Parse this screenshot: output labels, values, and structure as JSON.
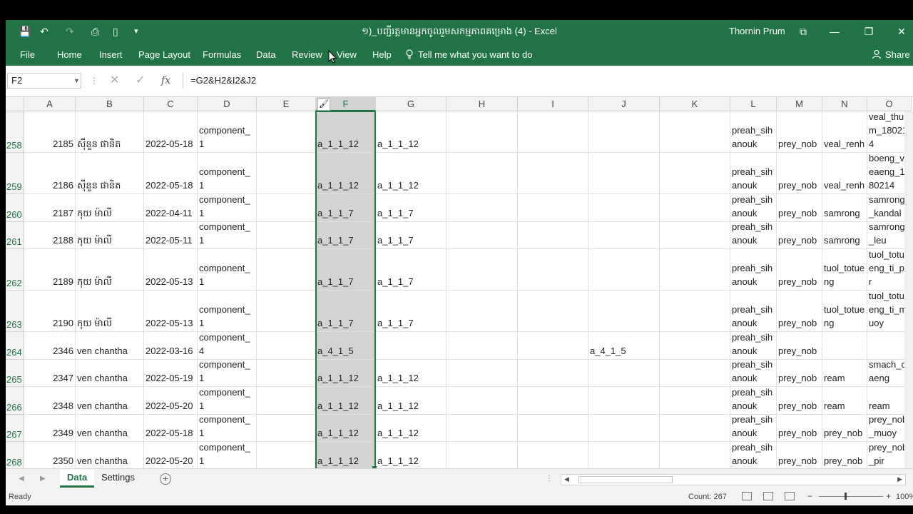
{
  "window": {
    "title": "១)_បញ្ជីរត្តមានអ្នកចូលរួមសកម្មភាពគម្រោង (4)  -  Excel",
    "user": "Thornin Prum",
    "minimize": "—",
    "restore": "❐",
    "close": "✕",
    "ribbon_display": "⧉"
  },
  "qat": {
    "save": "💾",
    "undo": "↶",
    "redo": "↷",
    "print_preview": "⎙",
    "new": "▯",
    "customize": "▾"
  },
  "ribbon": {
    "tabs": [
      "File",
      "Home",
      "Insert",
      "Page Layout",
      "Formulas",
      "Data",
      "Review",
      "View",
      "Help"
    ],
    "tell_me": "Tell me what you want to do",
    "share": "Share"
  },
  "formula_bar": {
    "name_box": "F2",
    "cancel": "✕",
    "enter": "✓",
    "fx": "fx",
    "formula": "=G2&H2&I2&J2"
  },
  "columns": [
    "A",
    "B",
    "C",
    "D",
    "E",
    "F",
    "G",
    "H",
    "I",
    "J",
    "K",
    "L",
    "M",
    "N",
    "O"
  ],
  "selected_column": "F",
  "rows": [
    {
      "num": "258",
      "A": "2185",
      "B": "ស៊ីនួន ផានិត",
      "C": "2022-05-18",
      "D": "component_1",
      "F": "a_1_1_12",
      "G": "a_1_1_12",
      "J": "",
      "L": "preah_sihanouk",
      "M": "prey_nob",
      "N": "veal_renh",
      "O": "veal_thum_180214"
    },
    {
      "num": "259",
      "A": "2186",
      "B": "ស៊ីនួន ផានិត",
      "C": "2022-05-18",
      "D": "component_1",
      "F": "a_1_1_12",
      "G": "a_1_1_12",
      "J": "",
      "L": "preah_sihanouk",
      "M": "prey_nob",
      "N": "veal_renh",
      "O": "boeng_veaeng_180214"
    },
    {
      "num": "260",
      "A": "2187",
      "B": "កុយ ម៉ាលី",
      "C": "2022-04-11",
      "D": "component_1",
      "F": "a_1_1_7",
      "G": "a_1_1_7",
      "J": "",
      "L": "preah_sihanouk",
      "M": "prey_nob",
      "N": "samrong",
      "O": "samrong_kandal"
    },
    {
      "num": "261",
      "A": "2188",
      "B": "កុយ ម៉ាលី",
      "C": "2022-05-11",
      "D": "component_1",
      "F": "a_1_1_7",
      "G": "a_1_1_7",
      "J": "",
      "L": "preah_sihanouk",
      "M": "prey_nob",
      "N": "samrong",
      "O": "samrong_leu"
    },
    {
      "num": "262",
      "A": "2189",
      "B": "កុយ ម៉ាលី",
      "C": "2022-05-13",
      "D": "component_1",
      "F": "a_1_1_7",
      "G": "a_1_1_7",
      "J": "",
      "L": "preah_sihanouk",
      "M": "prey_nob",
      "N": "tuol_totueng",
      "O": "tuol_totueng_ti_pir"
    },
    {
      "num": "263",
      "A": "2190",
      "B": "កុយ ម៉ាលី",
      "C": "2022-05-13",
      "D": "component_1",
      "F": "a_1_1_7",
      "G": "a_1_1_7",
      "J": "",
      "L": "preah_sihanouk",
      "M": "prey_nob",
      "N": "tuol_totueng",
      "O": "tuol_totueng_ti_muoy"
    },
    {
      "num": "264",
      "A": "2346",
      "B": "ven chantha",
      "C": "2022-03-16",
      "D": "component_4",
      "F": "a_4_1_5",
      "G": "",
      "J": "a_4_1_5",
      "L": "preah_sihanouk",
      "M": "prey_nob",
      "N": "",
      "O": ""
    },
    {
      "num": "265",
      "A": "2347",
      "B": "ven chantha",
      "C": "2022-05-19",
      "D": "component_1",
      "F": "a_1_1_12",
      "G": "a_1_1_12",
      "J": "",
      "L": "preah_sihanouk",
      "M": "prey_nob",
      "N": "ream",
      "O": "smach_daeng"
    },
    {
      "num": "266",
      "A": "2348",
      "B": "ven chantha",
      "C": "2022-05-20",
      "D": "component_1",
      "F": "a_1_1_12",
      "G": "a_1_1_12",
      "J": "",
      "L": "preah_sihanouk",
      "M": "prey_nob",
      "N": "ream",
      "O": "ream"
    },
    {
      "num": "267",
      "A": "2349",
      "B": "ven chantha",
      "C": "2022-05-18",
      "D": "component_1",
      "F": "a_1_1_12",
      "G": "a_1_1_12",
      "J": "",
      "L": "preah_sihanouk",
      "M": "prey_nob",
      "N": "prey_nob",
      "O": "prey_nob_muoy"
    },
    {
      "num": "268",
      "A": "2350",
      "B": "ven chantha",
      "C": "2022-05-20",
      "D": "component_1",
      "F": "a_1_1_12",
      "G": "a_1_1_12",
      "J": "",
      "L": "preah_sihanouk",
      "M": "prey_nob",
      "N": "prey_nob",
      "O": "prey_nob_pir"
    }
  ],
  "sheets": {
    "active": "Data",
    "other": "Settings",
    "add": "+"
  },
  "status": {
    "ready": "Ready",
    "count": "Count: 267",
    "zoom": "100%"
  },
  "colors": {
    "accent": "#217346",
    "selection": "#d3d3d3"
  }
}
